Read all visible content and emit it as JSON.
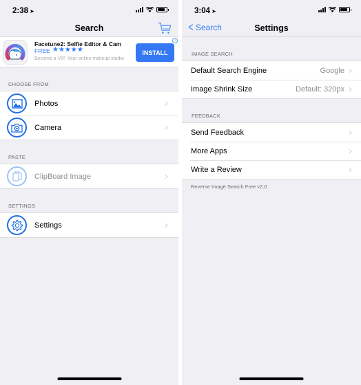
{
  "left_screen": {
    "status": {
      "time": "2:38",
      "location_icon": "location-arrow-icon"
    },
    "nav": {
      "title": "Search",
      "right_icon": "cart-icon"
    },
    "ad": {
      "title": "Facetune2: Selfie Editor & Cam",
      "price": "FREE",
      "stars": "★★★★★",
      "rating": 5,
      "subtitle": "Become a VIP. Your online makeup studio",
      "install_label": "INSTALL",
      "info_label": "i"
    },
    "sections": [
      {
        "header": "CHOOSE FROM",
        "items": [
          {
            "label": "Photos",
            "icon": "photos-icon"
          },
          {
            "label": "Camera",
            "icon": "camera-icon"
          }
        ]
      },
      {
        "header": "PASTE",
        "items": [
          {
            "label": "ClipBoard Image",
            "icon": "clipboard-icon",
            "disabled": true
          }
        ]
      },
      {
        "header": "SETTINGS",
        "items": [
          {
            "label": "Settings",
            "icon": "gear-icon"
          }
        ]
      }
    ]
  },
  "right_screen": {
    "status": {
      "time": "3:04"
    },
    "nav": {
      "back_label": "Search",
      "title": "Settings"
    },
    "sections": [
      {
        "header": "IMAGE SEARCH",
        "items": [
          {
            "label": "Default Search Engine",
            "value": "Google"
          },
          {
            "label": "Image Shrink Size",
            "value": "Default: 320px"
          }
        ]
      },
      {
        "header": "FEEDBACK",
        "items": [
          {
            "label": "Send Feedback"
          },
          {
            "label": "More Apps"
          },
          {
            "label": "Write a Review"
          }
        ]
      }
    ],
    "footer": "Reverse Image Search Free v2.0"
  },
  "colors": {
    "accent": "#2f7cf6",
    "install_bg": "#3478f6",
    "icon_ring": "#1f6fe6",
    "background": "#efeff4"
  }
}
